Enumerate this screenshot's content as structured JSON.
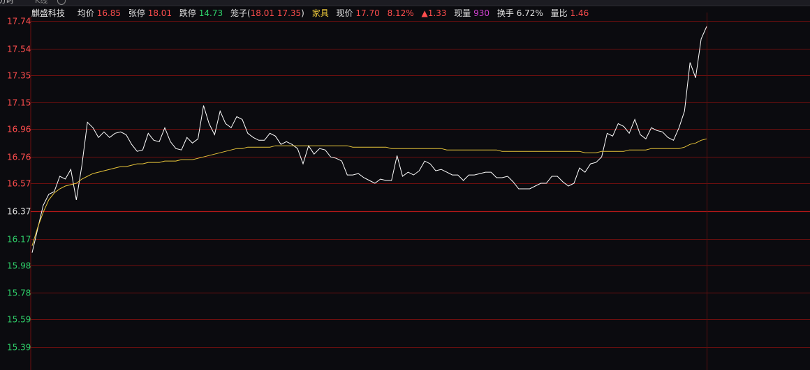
{
  "tabs": [
    {
      "label": "分时"
    },
    {
      "label": "K线"
    }
  ],
  "info": {
    "name": "麒盛科技",
    "avg_label": "均价",
    "avg_value": "16.85",
    "limit_up_label": "张停",
    "limit_up_value": "18.01",
    "limit_down_label": "跌停",
    "limit_down_value": "14.73",
    "cage_label": "笼子(",
    "cage_value1": "18.01",
    "cage_value2": "17.35",
    "cage_close": ")",
    "sector": "家具",
    "price_label": "现价",
    "price_value": "17.70",
    "change_pct": "8.12%",
    "change_value": "▲1.33",
    "volume_label": "现量",
    "volume_value": "930",
    "turnover_label": "换手",
    "turnover_value": "6.72%",
    "ratio_label": "量比",
    "ratio_value": "1.46"
  },
  "colors": {
    "background": "#0b0b0f",
    "grid": "#6e0f0f",
    "price_line": "#ffffff",
    "avg_line": "#e8c53a",
    "up": "#ff4d4d",
    "down": "#2fd06a",
    "neutral": "#e0e0e0"
  },
  "chart_data": {
    "type": "line",
    "title": "",
    "xlabel": "",
    "ylabel": "",
    "ylim": [
      15.39,
      17.74
    ],
    "reference_price": 16.37,
    "y_ticks": [
      "17.74",
      "17.54",
      "17.35",
      "17.15",
      "16.96",
      "16.76",
      "16.57",
      "16.37",
      "16.17",
      "15.98",
      "15.78",
      "15.59",
      "15.39"
    ],
    "grid": true,
    "series": [
      {
        "key": "price",
        "values": [
          16.07,
          16.24,
          16.41,
          16.49,
          16.51,
          16.62,
          16.6,
          16.67,
          16.45,
          16.7,
          17.01,
          16.97,
          16.9,
          16.94,
          16.9,
          16.93,
          16.94,
          16.92,
          16.85,
          16.8,
          16.81,
          16.93,
          16.88,
          16.87,
          16.97,
          16.87,
          16.82,
          16.81,
          16.9,
          16.86,
          16.89,
          17.13,
          17.0,
          16.92,
          17.09,
          17.0,
          16.97,
          17.05,
          17.03,
          16.93,
          16.9,
          16.88,
          16.88,
          16.93,
          16.91,
          16.85,
          16.87,
          16.85,
          16.82,
          16.71,
          16.84,
          16.78,
          16.82,
          16.81,
          16.76,
          16.75,
          16.73,
          16.63,
          16.63,
          16.64,
          16.61,
          16.59,
          16.57,
          16.6,
          16.59,
          16.59,
          16.77,
          16.62,
          16.65,
          16.63,
          16.66,
          16.73,
          16.71,
          16.66,
          16.67,
          16.65,
          16.63,
          16.63,
          16.59,
          16.63,
          16.63,
          16.64,
          16.65,
          16.65,
          16.61,
          16.61,
          16.62,
          16.58,
          16.53,
          16.53,
          16.53,
          16.55,
          16.57,
          16.57,
          16.62,
          16.62,
          16.58,
          16.55,
          16.57,
          16.68,
          16.65,
          16.71,
          16.72,
          16.76,
          16.93,
          16.91,
          17.0,
          16.98,
          16.93,
          17.03,
          16.92,
          16.89,
          16.97,
          16.95,
          16.94,
          16.9,
          16.88,
          16.97,
          17.09,
          17.44,
          17.33,
          17.61,
          17.7
        ]
      },
      {
        "key": "avg",
        "values": [
          16.12,
          16.25,
          16.36,
          16.45,
          16.5,
          16.53,
          16.55,
          16.56,
          16.57,
          16.6,
          16.62,
          16.64,
          16.65,
          16.66,
          16.67,
          16.68,
          16.69,
          16.69,
          16.7,
          16.71,
          16.71,
          16.72,
          16.72,
          16.72,
          16.73,
          16.73,
          16.73,
          16.74,
          16.74,
          16.74,
          16.75,
          16.76,
          16.77,
          16.78,
          16.79,
          16.8,
          16.81,
          16.82,
          16.82,
          16.83,
          16.83,
          16.83,
          16.83,
          16.83,
          16.84,
          16.84,
          16.84,
          16.84,
          16.84,
          16.84,
          16.84,
          16.84,
          16.84,
          16.84,
          16.84,
          16.84,
          16.84,
          16.84,
          16.83,
          16.83,
          16.83,
          16.83,
          16.83,
          16.83,
          16.83,
          16.82,
          16.82,
          16.82,
          16.82,
          16.82,
          16.82,
          16.82,
          16.82,
          16.82,
          16.82,
          16.81,
          16.81,
          16.81,
          16.81,
          16.81,
          16.81,
          16.81,
          16.81,
          16.81,
          16.81,
          16.8,
          16.8,
          16.8,
          16.8,
          16.8,
          16.8,
          16.8,
          16.8,
          16.8,
          16.8,
          16.8,
          16.8,
          16.8,
          16.8,
          16.8,
          16.79,
          16.79,
          16.79,
          16.8,
          16.8,
          16.8,
          16.8,
          16.8,
          16.81,
          16.81,
          16.81,
          16.81,
          16.82,
          16.82,
          16.82,
          16.82,
          16.82,
          16.82,
          16.83,
          16.85,
          16.86,
          16.88,
          16.89
        ]
      }
    ]
  }
}
